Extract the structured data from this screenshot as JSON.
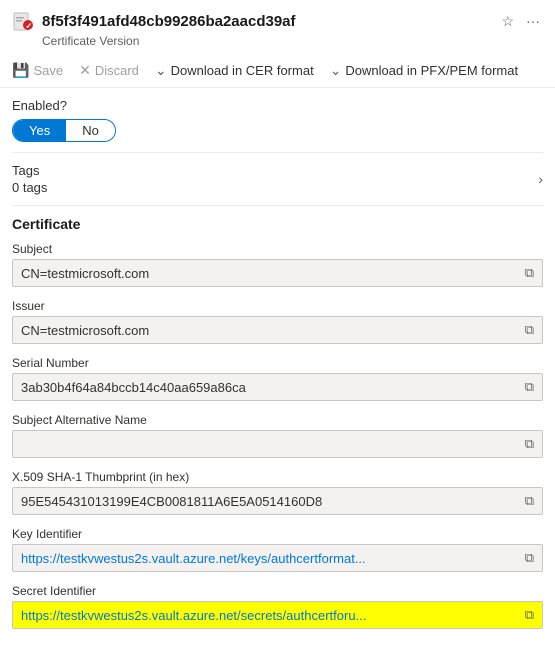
{
  "header": {
    "title": "8f5f3f491afd48cb99286ba2aacd39af",
    "subtitle": "Certificate Version",
    "pin_icon": "☆",
    "more_icon": "···"
  },
  "toolbar": {
    "save_label": "Save",
    "discard_label": "Discard",
    "download_cer_label": "Download in CER format",
    "download_pfx_label": "Download in PFX/PEM format"
  },
  "enabled": {
    "label": "Enabled?",
    "yes_label": "Yes",
    "no_label": "No"
  },
  "tags": {
    "label": "Tags",
    "value": "0 tags"
  },
  "certificate": {
    "section_label": "Certificate",
    "subject": {
      "label": "Subject",
      "value": "CN=testmicrosoft.com"
    },
    "issuer": {
      "label": "Issuer",
      "value": "CN=testmicrosoft.com"
    },
    "serial_number": {
      "label": "Serial Number",
      "value": "3ab30b4f64a84bccb14c40aa659a86ca"
    },
    "subject_alt_name": {
      "label": "Subject Alternative Name",
      "value": ""
    },
    "thumbprint": {
      "label": "X.509 SHA-1 Thumbprint (in hex)",
      "value": "95E545431013199E4CB0081811A6E5A0514160D8"
    },
    "key_identifier": {
      "label": "Key Identifier",
      "value": "https://testkvwestus2s.vault.azure.net/keys/authcertformat..."
    },
    "secret_identifier": {
      "label": "Secret Identifier",
      "value": "https://testkvwestus2s.vault.azure.net/secrets/authcertforu..."
    }
  }
}
